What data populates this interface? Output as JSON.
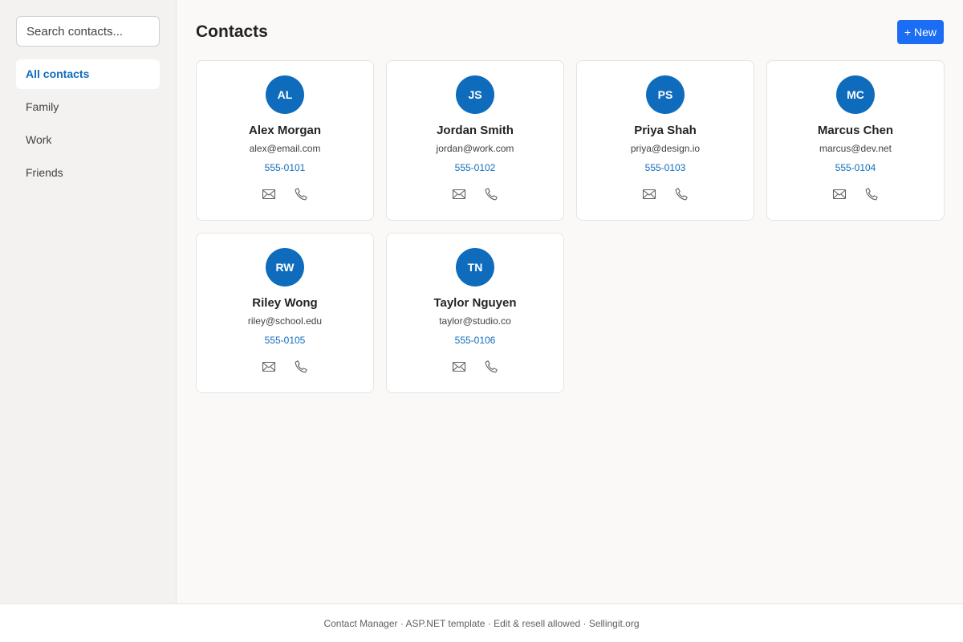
{
  "sidebar": {
    "search_placeholder": "Search contacts...",
    "items": [
      {
        "label": "All contacts",
        "active": true
      },
      {
        "label": "Family",
        "active": false
      },
      {
        "label": "Work",
        "active": false
      },
      {
        "label": "Friends",
        "active": false
      }
    ]
  },
  "header": {
    "title": "Contacts",
    "new_label": "+ New"
  },
  "contacts": [
    {
      "initials": "AL",
      "name": "Alex Morgan",
      "email": "alex@email.com",
      "phone": "555-0101"
    },
    {
      "initials": "JS",
      "name": "Jordan Smith",
      "email": "jordan@work.com",
      "phone": "555-0102"
    },
    {
      "initials": "PS",
      "name": "Priya Shah",
      "email": "priya@design.io",
      "phone": "555-0103"
    },
    {
      "initials": "MC",
      "name": "Marcus Chen",
      "email": "marcus@dev.net",
      "phone": "555-0104"
    },
    {
      "initials": "RW",
      "name": "Riley Wong",
      "email": "riley@school.edu",
      "phone": "555-0105"
    },
    {
      "initials": "TN",
      "name": "Taylor Nguyen",
      "email": "taylor@studio.co",
      "phone": "555-0106"
    }
  ],
  "card_actions": {
    "email_icon": "mail-icon",
    "call_icon": "phone-icon"
  },
  "footer": {
    "text": "Contact Manager · ASP.NET template · Edit & resell allowed · Sellingit.org"
  },
  "colors": {
    "accent": "#0f6cbd",
    "primary_button": "#1b6ef3",
    "sidebar_bg": "#f3f2f1",
    "page_bg": "#faf9f8"
  }
}
